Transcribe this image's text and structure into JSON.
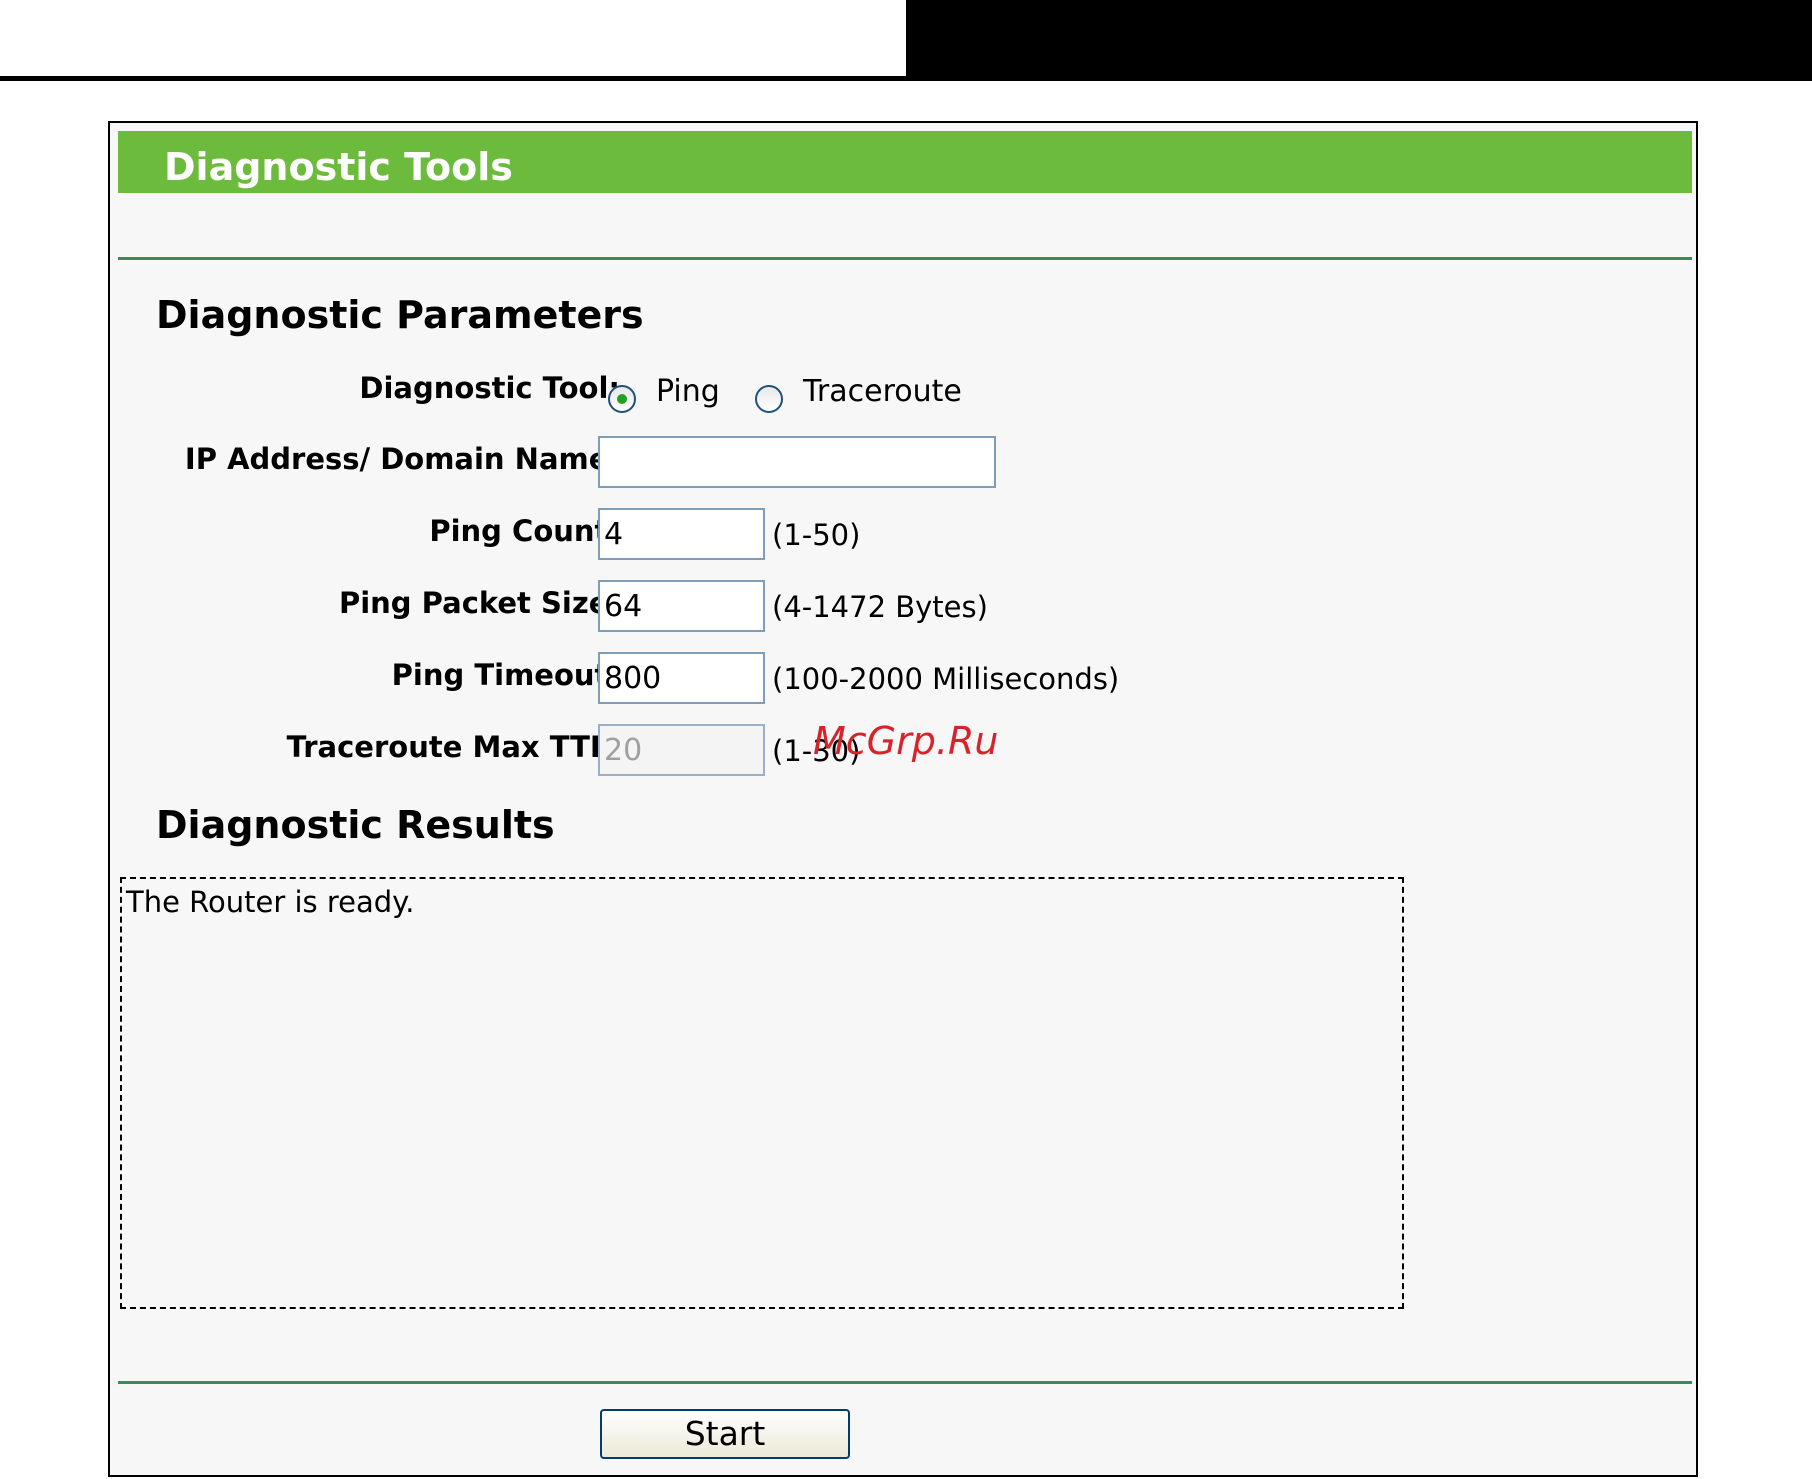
{
  "page": {
    "title": "Diagnostic Tools"
  },
  "parameters": {
    "heading": "Diagnostic Parameters",
    "diagnostic_tool": {
      "label": "Diagnostic Tool:",
      "options": [
        "Ping",
        "Traceroute"
      ],
      "selected": "Ping"
    },
    "ip_address": {
      "label": "IP Address/ Domain Name:",
      "value": ""
    },
    "ping_count": {
      "label": "Ping Count:",
      "value": "4",
      "hint": "(1-50)"
    },
    "ping_packet_size": {
      "label": "Ping Packet Size:",
      "value": "64",
      "hint": "(4-1472 Bytes)"
    },
    "ping_timeout": {
      "label": "Ping Timeout:",
      "value": "800",
      "hint": "(100-2000 Milliseconds)"
    },
    "traceroute_max_ttl": {
      "label": "Traceroute Max TTL:",
      "value": "20",
      "hint": "(1-30)",
      "disabled": true
    }
  },
  "results": {
    "heading": "Diagnostic Results",
    "text": "The Router is ready."
  },
  "actions": {
    "start_label": "Start"
  },
  "watermark": "McGrp.Ru",
  "colors": {
    "title_bar": "#6cbb3c",
    "rule": "#3a8a5a",
    "radio_dot": "#21a121"
  }
}
